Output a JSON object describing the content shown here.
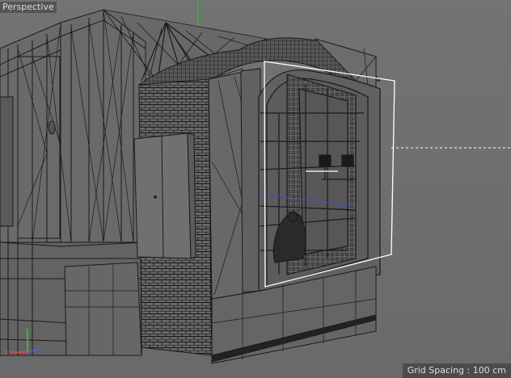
{
  "viewport": {
    "view_name": "Perspective",
    "grid_spacing_text": "Grid Spacing : 100 cm"
  },
  "axes": {
    "x_color": "#e84a4a",
    "y_color": "#3ad23a",
    "z_color": "#4a66ff"
  },
  "colors": {
    "background": "#6e6e6e",
    "wire": "#1a1a1a",
    "selection": "#ffffff",
    "y_axis_line": "#2fbf2f"
  }
}
